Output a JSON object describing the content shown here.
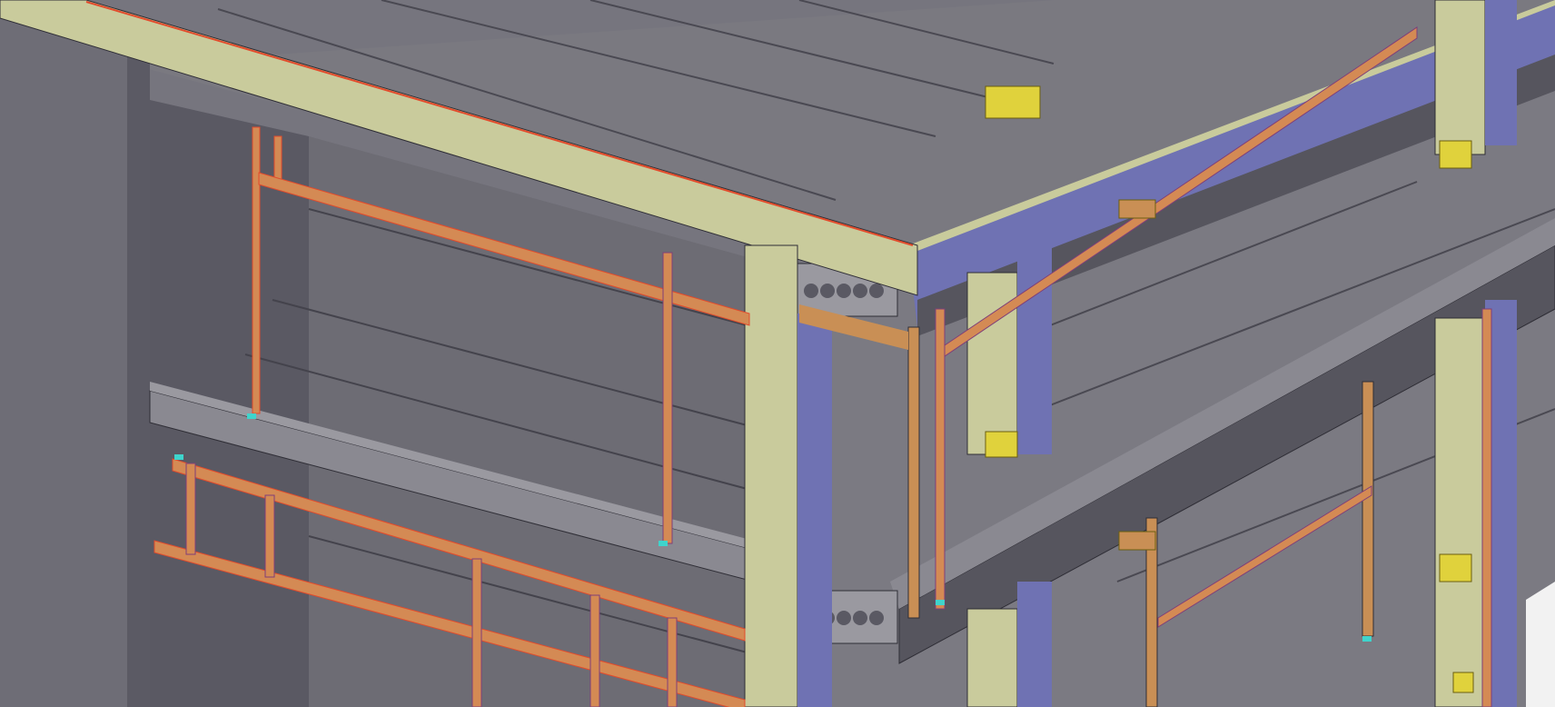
{
  "viewport": {
    "kind": "3d-structural-model-view",
    "text_labels": []
  },
  "colors": {
    "background": "#76757e",
    "slab_top": "#7a7980",
    "slab_dark": "#56555e",
    "slab_side": "#4f4e58",
    "wall_dark": "#5b5a64",
    "precast_column_light": "#c9cb9c",
    "precast_column_shade": "#b9bb8c",
    "column_side_blue": "#6f72b3",
    "steel_orange": "#d48a54",
    "steel_red": "#e24b2c",
    "steel_purple": "#7f3f79",
    "steel_brown": "#c98f55",
    "connector_yellow": "#e0d23c",
    "anchor_cyan": "#3fd4cc",
    "edge_line": "#2f2e36"
  },
  "elements": {
    "precast_beams": [
      "beam-front-long",
      "beam-right-long",
      "beam-mid-level"
    ],
    "columns": [
      "column-center",
      "column-right-mid",
      "column-far-right"
    ],
    "steel_frames": [
      "steel-frame-left-upper",
      "steel-frame-left-lower",
      "steel-frame-center",
      "steel-frame-right"
    ],
    "hollow_core_slabs": [
      "slab-upper",
      "slab-mid",
      "slab-right"
    ]
  }
}
